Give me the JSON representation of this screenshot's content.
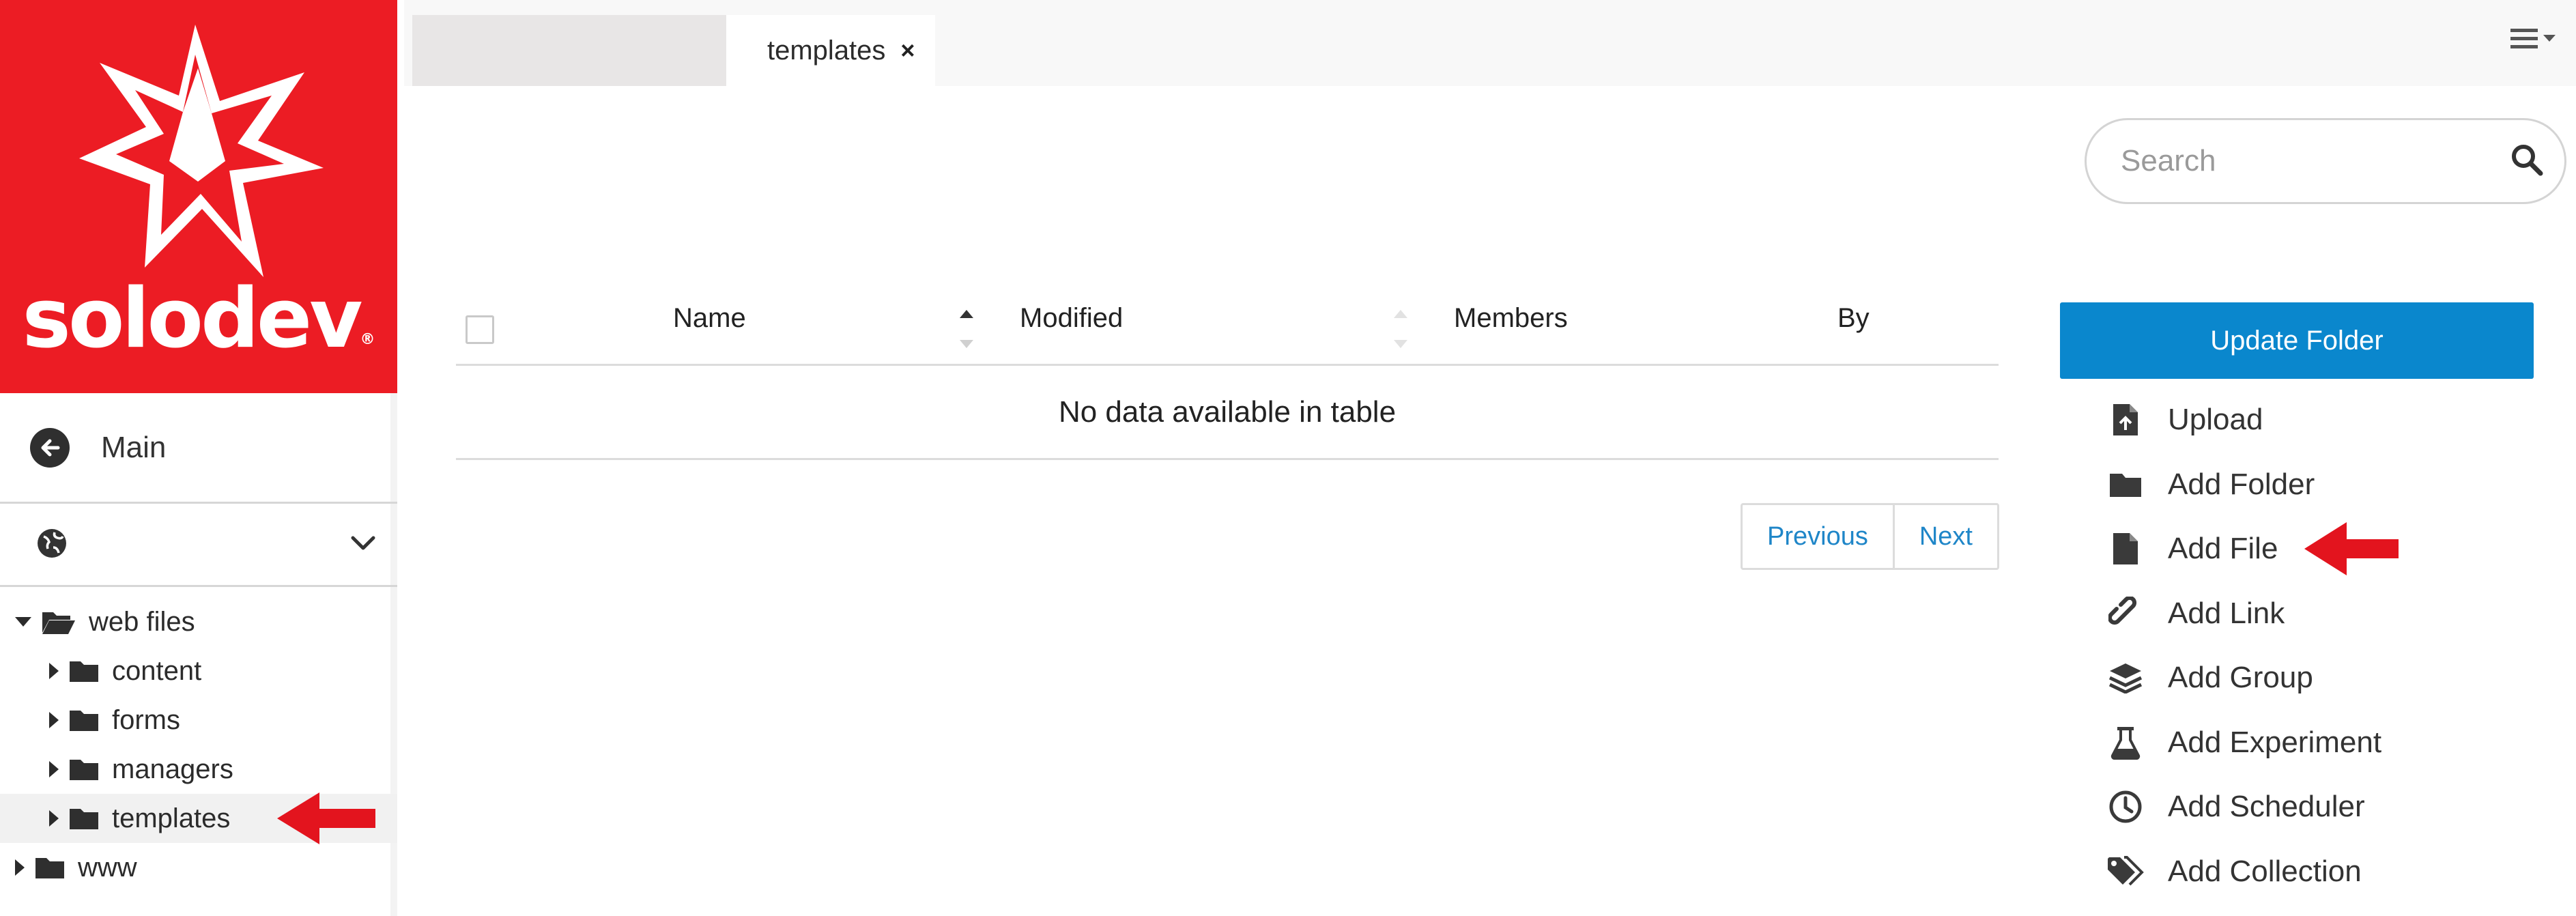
{
  "sidebar": {
    "brand": {
      "name": "solodev",
      "mark": "®",
      "color": "#ec1c24"
    },
    "main_nav": {
      "label": "Main",
      "icon": "arrow-left-circle-icon"
    },
    "site_select": {
      "icon": "globe-icon",
      "chevron": "chevron-down-icon"
    },
    "tree": {
      "root": {
        "label": "web files",
        "expanded": true
      },
      "children": [
        {
          "label": "content"
        },
        {
          "label": "forms"
        },
        {
          "label": "managers"
        },
        {
          "label": "templates",
          "selected": true
        }
      ],
      "sibling": {
        "label": "www"
      }
    }
  },
  "topbar": {
    "active_tab": {
      "label": "templates",
      "close": "×"
    },
    "menu_icon": "hamburger-menu-icon"
  },
  "search": {
    "placeholder": "Search",
    "icon": "search-icon"
  },
  "table": {
    "columns": [
      "Name",
      "Modified",
      "Members",
      "By"
    ],
    "empty_message": "No data available in table"
  },
  "pagination": {
    "previous": "Previous",
    "next": "Next"
  },
  "actions": {
    "update_folder": "Update Folder",
    "items": [
      {
        "label": "Upload",
        "icon": "file-upload-icon"
      },
      {
        "label": "Add Folder",
        "icon": "folder-icon"
      },
      {
        "label": "Add File",
        "icon": "file-icon"
      },
      {
        "label": "Add Link",
        "icon": "link-icon"
      },
      {
        "label": "Add Group",
        "icon": "layers-icon"
      },
      {
        "label": "Add Experiment",
        "icon": "flask-icon"
      },
      {
        "label": "Add Scheduler",
        "icon": "clock-icon"
      },
      {
        "label": "Add Collection",
        "icon": "tags-icon"
      }
    ]
  },
  "colors": {
    "accent": "#0a87cd",
    "brand": "#ec1c24",
    "link": "#1f86c8",
    "annotation": "#e3141e"
  }
}
